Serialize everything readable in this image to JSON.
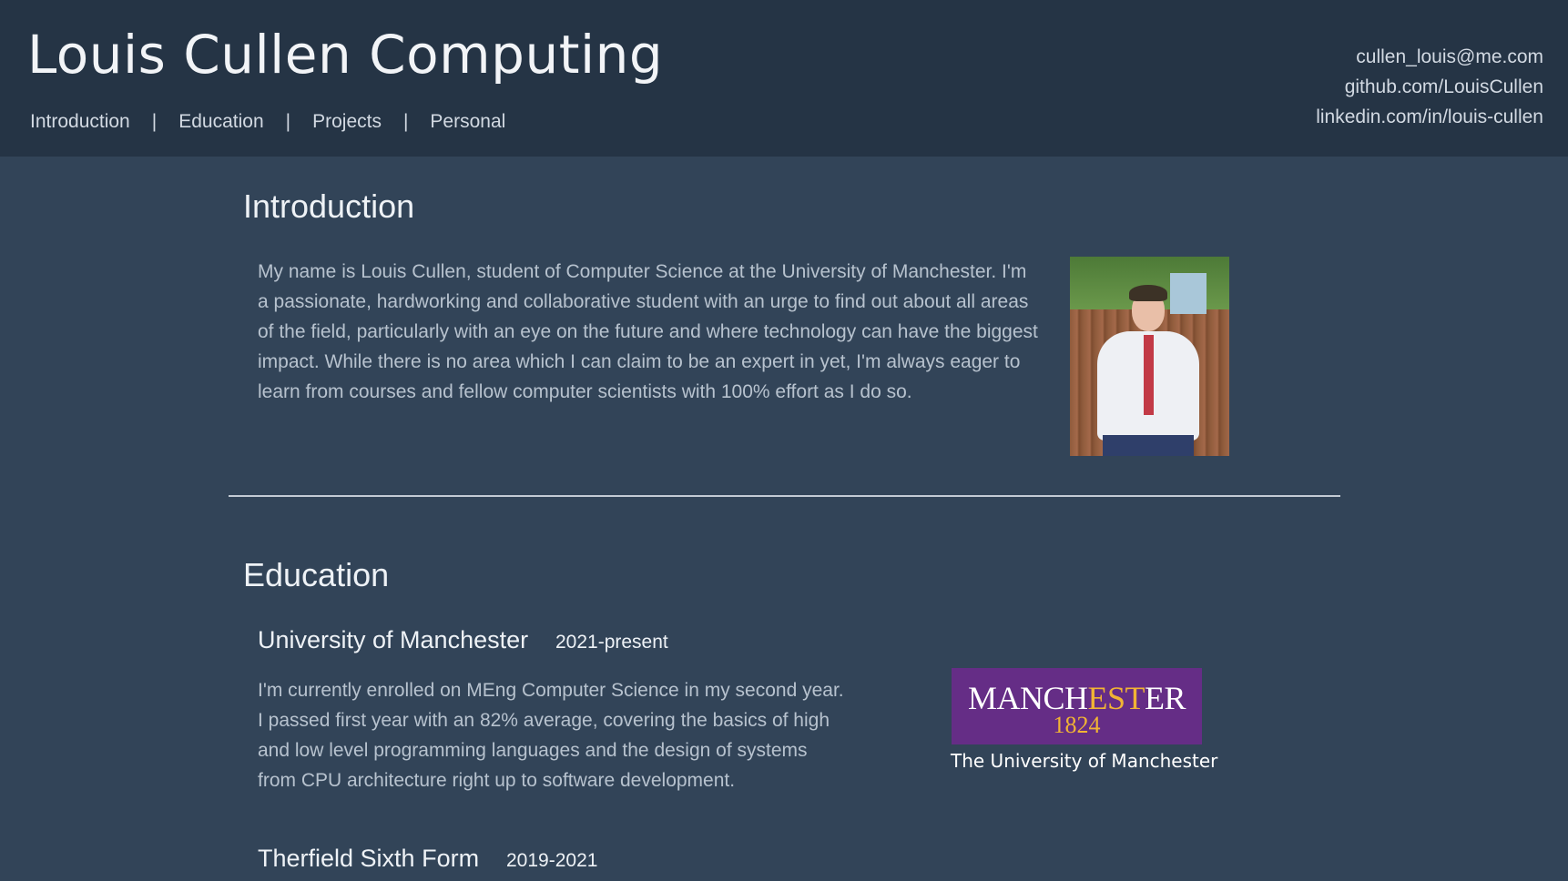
{
  "header": {
    "site_title": "Louis Cullen Computing",
    "nav": [
      {
        "label": "Introduction"
      },
      {
        "label": "Education"
      },
      {
        "label": "Projects"
      },
      {
        "label": "Personal"
      }
    ],
    "nav_separator": "|",
    "contact": {
      "email": "cullen_louis@me.com",
      "github": "github.com/LouisCullen",
      "linkedin": "linkedin.com/in/louis-cullen"
    }
  },
  "introduction": {
    "heading": "Introduction",
    "text": "My name is Louis Cullen, student of Computer Science at the University of Manchester. I'm a passionate, hardworking and collaborative student with an urge to find out about all areas of the field, particularly with an eye on the future and where technology can have the biggest impact. While there is no area which I can claim to be an expert in yet, I'm always eager to learn from courses and fellow computer scientists with 100% effort as I do so."
  },
  "education": {
    "heading": "Education",
    "entries": [
      {
        "school": "University of Manchester",
        "years": "2021-present",
        "text": "I'm currently enrolled on MEng Computer Science in my second year. I passed first year with an 82% average, covering the basics of high and low level programming languages and the design of systems from CPU architecture right up to software development."
      },
      {
        "school": "Therfield Sixth Form",
        "years": "2019-2021"
      }
    ],
    "logo": {
      "word_start": "MANCH",
      "word_accent": "EST",
      "word_end": "ER",
      "year": "1824",
      "caption": "The University of Manchester"
    }
  },
  "colors": {
    "header_bg": "#253445",
    "page_bg": "#324458",
    "logo_purple": "#652d86",
    "logo_gold": "#f1b434"
  }
}
